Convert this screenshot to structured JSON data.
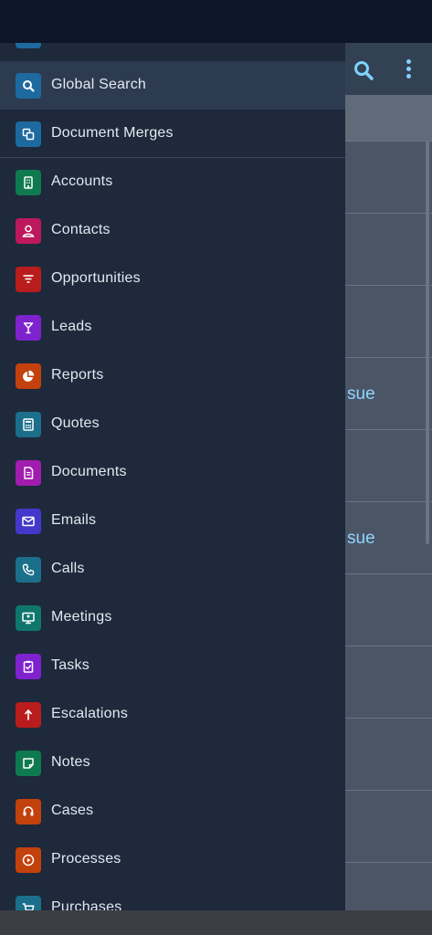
{
  "colors": {
    "drawer_bg": "#1e293b",
    "active_bg": "#2d3b51",
    "label": "#e2e8f0",
    "accent": "#7dd3fc"
  },
  "background": {
    "rows": [
      {
        "text": ""
      },
      {
        "text": ""
      },
      {
        "text": ""
      },
      {
        "text": "sue"
      },
      {
        "text": ""
      },
      {
        "text": "sue"
      },
      {
        "text": ""
      },
      {
        "text": ""
      },
      {
        "text": ""
      },
      {
        "text": ""
      },
      {
        "text": ""
      }
    ]
  },
  "menu": {
    "items": [
      {
        "label": "Global Search",
        "icon": "search-icon",
        "color": "#1d6aa0"
      },
      {
        "label": "Document Merges",
        "icon": "copy-icon",
        "color": "#1d6aa0"
      },
      {
        "label": "Accounts",
        "icon": "building-icon",
        "color": "#0f7a4f"
      },
      {
        "label": "Contacts",
        "icon": "user-icon",
        "color": "#be185d"
      },
      {
        "label": "Opportunities",
        "icon": "filter-icon",
        "color": "#b91c1c"
      },
      {
        "label": "Leads",
        "icon": "cocktail-icon",
        "color": "#7e22ce"
      },
      {
        "label": "Reports",
        "icon": "pie-chart-icon",
        "color": "#c2410c"
      },
      {
        "label": "Quotes",
        "icon": "calculator-icon",
        "color": "#1b6f8a"
      },
      {
        "label": "Documents",
        "icon": "document-icon",
        "color": "#a21caf"
      },
      {
        "label": "Emails",
        "icon": "envelope-icon",
        "color": "#4338ca"
      },
      {
        "label": "Calls",
        "icon": "phone-icon",
        "color": "#1b6f8a"
      },
      {
        "label": "Meetings",
        "icon": "presentation-icon",
        "color": "#0f766e"
      },
      {
        "label": "Tasks",
        "icon": "clipboard-check-icon",
        "color": "#7e22ce"
      },
      {
        "label": "Escalations",
        "icon": "arrow-up-icon",
        "color": "#b91c1c"
      },
      {
        "label": "Notes",
        "icon": "sticky-note-icon",
        "color": "#0f7a4f"
      },
      {
        "label": "Cases",
        "icon": "headset-icon",
        "color": "#c2410c"
      },
      {
        "label": "Processes",
        "icon": "play-circle-icon",
        "color": "#c2410c"
      },
      {
        "label": "Purchases",
        "icon": "cart-icon",
        "color": "#1b6f8a"
      }
    ]
  }
}
